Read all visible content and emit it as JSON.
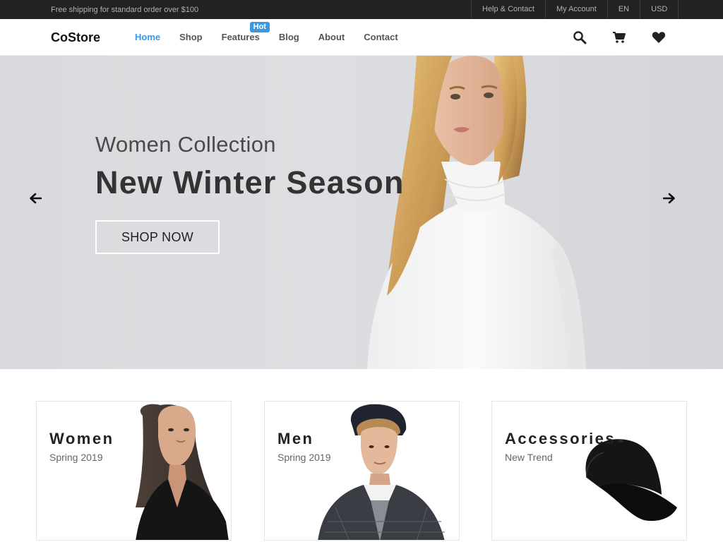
{
  "topbar": {
    "shipping_text": "Free shipping for standard order over $100",
    "links": [
      "Help & Contact",
      "My Account",
      "EN",
      "USD"
    ]
  },
  "header": {
    "logo": "CoStore",
    "nav": [
      {
        "label": "Home",
        "active": true
      },
      {
        "label": "Shop"
      },
      {
        "label": "Features",
        "badge": "Hot"
      },
      {
        "label": "Blog"
      },
      {
        "label": "About"
      },
      {
        "label": "Contact"
      }
    ],
    "icons": [
      "search-icon",
      "cart-icon",
      "heart-icon"
    ]
  },
  "hero": {
    "subtitle": "Women Collection",
    "title": "New Winter Season",
    "button": "SHOP NOW",
    "prev_icon": "arrow-left-icon",
    "next_icon": "arrow-right-icon"
  },
  "categories": [
    {
      "name": "Women",
      "subtitle": "Spring 2019"
    },
    {
      "name": "Men",
      "subtitle": "Spring 2019"
    },
    {
      "name": "Accessories",
      "subtitle": "New Trend"
    }
  ],
  "colors": {
    "accent": "#3b97e0",
    "topbar_bg": "#222222",
    "topbar_text": "#b2b2b2",
    "hero_bg": "#dadcdf"
  }
}
